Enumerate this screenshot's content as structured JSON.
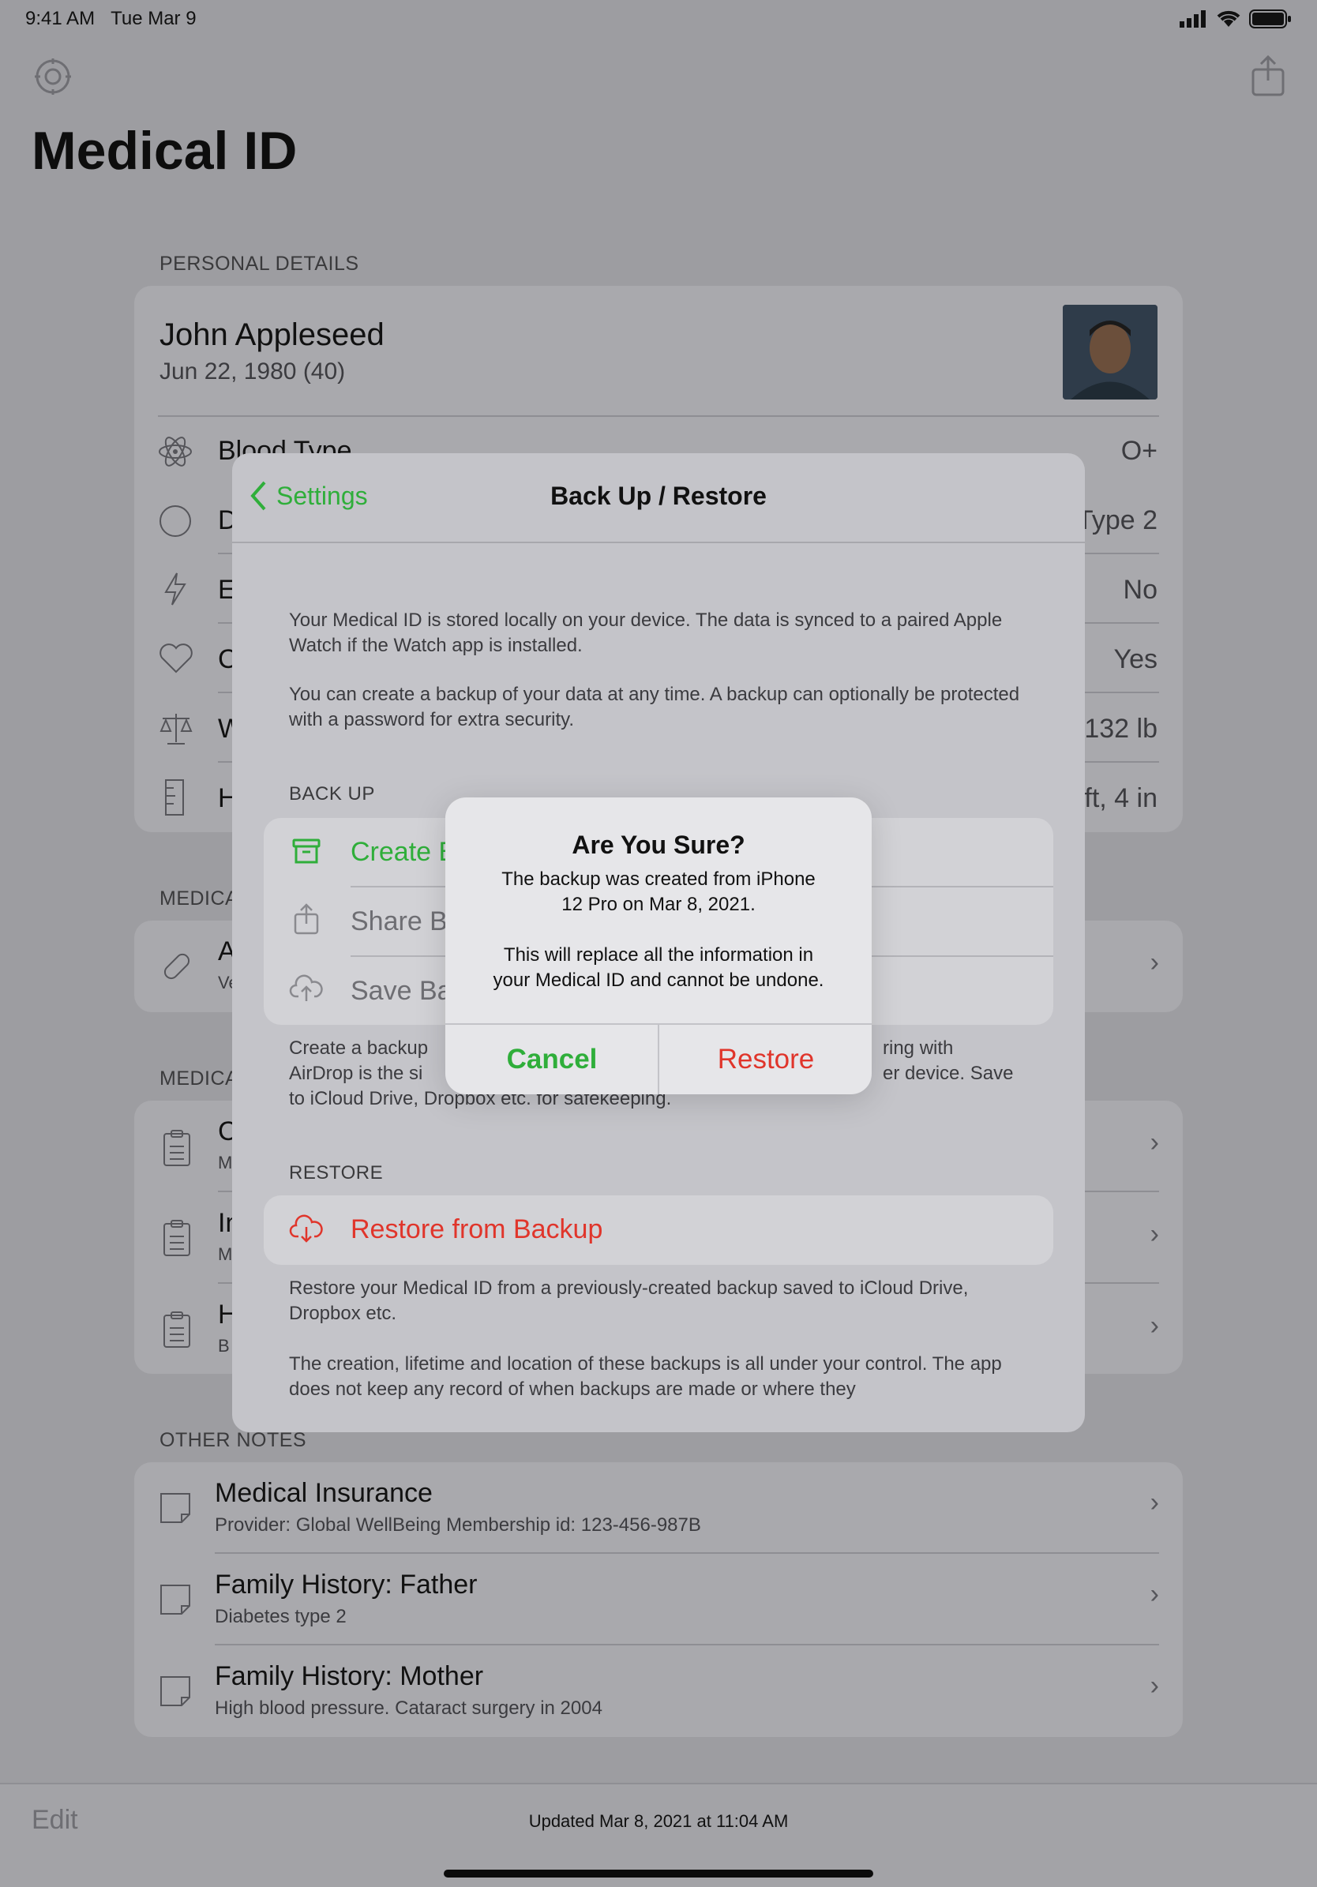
{
  "status_bar": {
    "time": "9:41 AM",
    "date": "Tue Mar 9"
  },
  "page": {
    "title": "Medical ID"
  },
  "personal": {
    "header": "PERSONAL DETAILS",
    "name": "John Appleseed",
    "dob": "Jun 22, 1980 (40)",
    "rows": [
      {
        "label": "Blood Type",
        "value": "O+"
      },
      {
        "label": "D",
        "value": "Type 2"
      },
      {
        "label": "E",
        "value": "No"
      },
      {
        "label": "C",
        "value": "Yes"
      },
      {
        "label": "W",
        "value": "132 lb"
      },
      {
        "label": "H",
        "value": "ft, 4 in"
      }
    ]
  },
  "medica_sections": [
    {
      "header": "MEDICA",
      "items": [
        {
          "title": "A",
          "sub": "Ve"
        }
      ]
    },
    {
      "header": "MEDICA",
      "items": [
        {
          "title": "C",
          "sub": "M"
        },
        {
          "title": "In",
          "sub": "M"
        },
        {
          "title": "H",
          "sub": "B"
        }
      ]
    }
  ],
  "other_notes": {
    "header": "OTHER NOTES",
    "items": [
      {
        "title": "Medical Insurance",
        "sub": "Provider: Global WellBeing Membership id: 123-456-987B"
      },
      {
        "title": "Family History: Father",
        "sub": "Diabetes type 2"
      },
      {
        "title": "Family History: Mother",
        "sub": "High blood pressure. Cataract surgery in 2004"
      }
    ]
  },
  "footer": {
    "edit": "Edit",
    "updated": "Updated Mar 8, 2021 at 11:04 AM"
  },
  "sheet": {
    "back_label": "Settings",
    "title": "Back Up / Restore",
    "intro_1": "Your Medical ID is stored locally on your device. The data is synced to a paired Apple Watch if the Watch app is installed.",
    "intro_2": "You can create a backup of your data at any time. A backup can optionally be protected with a password for extra security.",
    "backup_header": "BACK UP",
    "backup_items": [
      "Create B",
      "Share B",
      "Save Ba"
    ],
    "backup_note_left_1": "Create a backup",
    "backup_note_right_1": "ring with",
    "backup_note_left_2": "AirDrop is the si",
    "backup_note_right_2": "er device. Save",
    "backup_note_3": "to iCloud Drive, Dropbox etc. for safekeeping.",
    "restore_header": "RESTORE",
    "restore_item": "Restore from Backup",
    "restore_note": "Restore your Medical ID from a previously-created backup saved to iCloud Drive, Dropbox etc.",
    "control_note": "The creation, lifetime and location of these backups is all under your control. The app does not keep any record of when backups are made or where they"
  },
  "alert": {
    "title": "Are You Sure?",
    "line1": "The backup was created from iPhone",
    "line2": "12 Pro on Mar 8, 2021.",
    "line3": "This will replace all the information in",
    "line4": "your Medical ID and cannot be undone.",
    "cancel": "Cancel",
    "restore": "Restore"
  },
  "colors": {
    "green": "#2fae3a",
    "red": "#e0352b"
  }
}
